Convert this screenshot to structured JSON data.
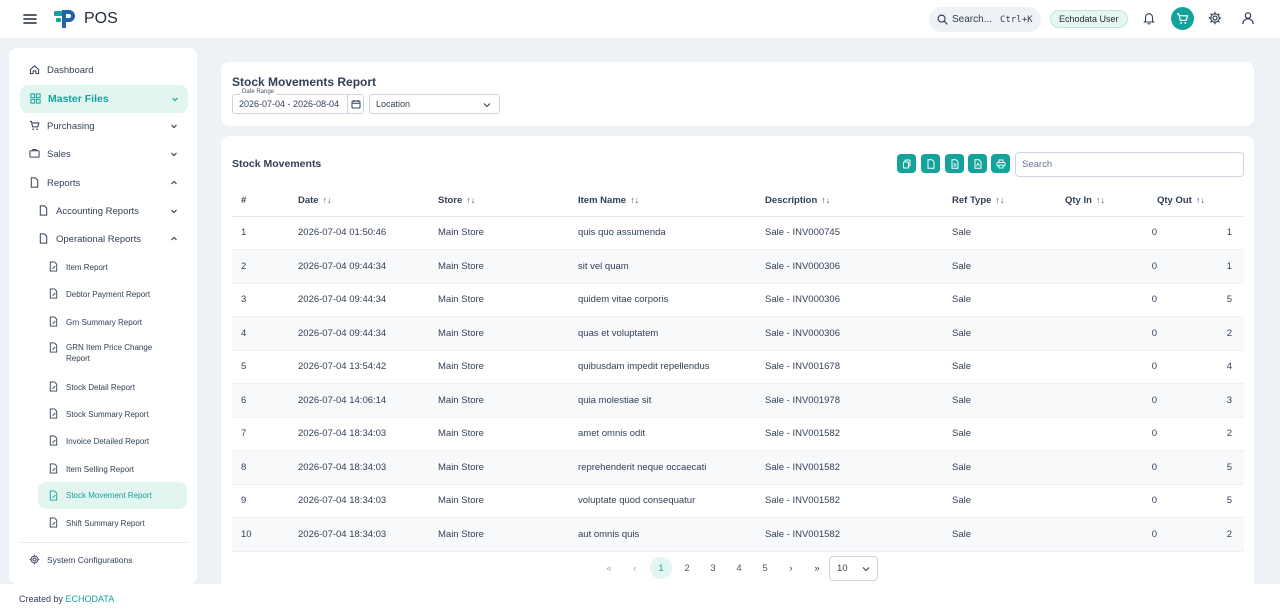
{
  "app": {
    "title": "POS"
  },
  "topbar": {
    "search_label": "Search...",
    "search_shortcut": "Ctrl+K",
    "user_name": "Echodata User"
  },
  "sidebar": {
    "dashboard": "Dashboard",
    "master_files": "Master Files",
    "purchasing": "Purchasing",
    "sales": "Sales",
    "reports": "Reports",
    "accounting_reports": "Accounting Reports",
    "operational_reports": "Operational Reports",
    "report_items": [
      "Item Report",
      "Debtor Payment Report",
      "Grn Summary Report",
      "GRN Item Price Change Report",
      "Stock Detail Report",
      "Stock Summary Report",
      "Invoice Detailed Report",
      "Item Selling Report",
      "Stock Movement Report",
      "Shift Summary Report"
    ],
    "system_configurations": "System Configurations"
  },
  "report": {
    "title": "Stock Movements Report",
    "date_range_label": "Date Range",
    "date_range_value": "2026-07-04 - 2026-08-04",
    "location_placeholder": "Location"
  },
  "table": {
    "title": "Stock Movements",
    "search_placeholder": "Search",
    "columns": [
      "#",
      "Date",
      "Store",
      "Item Name",
      "Description",
      "Ref Type",
      "Qty In",
      "Qty Out"
    ],
    "rows": [
      [
        "1",
        "2026-07-04 01:50:46",
        "Main Store",
        "quis quo assumenda",
        "Sale - INV000745",
        "Sale",
        "0",
        "1"
      ],
      [
        "2",
        "2026-07-04 09:44:34",
        "Main Store",
        "sit vel quam",
        "Sale - INV000306",
        "Sale",
        "0",
        "1"
      ],
      [
        "3",
        "2026-07-04 09:44:34",
        "Main Store",
        "quidem vitae corporis",
        "Sale - INV000306",
        "Sale",
        "0",
        "5"
      ],
      [
        "4",
        "2026-07-04 09:44:34",
        "Main Store",
        "quas et voluptatem",
        "Sale - INV000306",
        "Sale",
        "0",
        "2"
      ],
      [
        "5",
        "2026-07-04 13:54:42",
        "Main Store",
        "quibusdam impedit repellendus",
        "Sale - INV001678",
        "Sale",
        "0",
        "4"
      ],
      [
        "6",
        "2026-07-04 14:06:14",
        "Main Store",
        "quia molestiae sit",
        "Sale - INV001978",
        "Sale",
        "0",
        "3"
      ],
      [
        "7",
        "2026-07-04 18:34:03",
        "Main Store",
        "amet omnis odit",
        "Sale - INV001582",
        "Sale",
        "0",
        "2"
      ],
      [
        "8",
        "2026-07-04 18:34:03",
        "Main Store",
        "reprehenderit neque occaecati",
        "Sale - INV001582",
        "Sale",
        "0",
        "5"
      ],
      [
        "9",
        "2026-07-04 18:34:03",
        "Main Store",
        "voluptate quod consequatur",
        "Sale - INV001582",
        "Sale",
        "0",
        "5"
      ],
      [
        "10",
        "2026-07-04 18:34:03",
        "Main Store",
        "aut omnis quis",
        "Sale - INV001582",
        "Sale",
        "0",
        "2"
      ]
    ]
  },
  "pagination": {
    "pages": [
      "1",
      "2",
      "3",
      "4",
      "5"
    ],
    "current_page": "1",
    "rows_per_page": "10"
  },
  "footer": {
    "prefix": "Created by",
    "brand": "ECHODATA"
  },
  "colors": {
    "accent": "#14a39a",
    "accent_soft": "#e3f5f1",
    "background": "#eef1f5"
  }
}
